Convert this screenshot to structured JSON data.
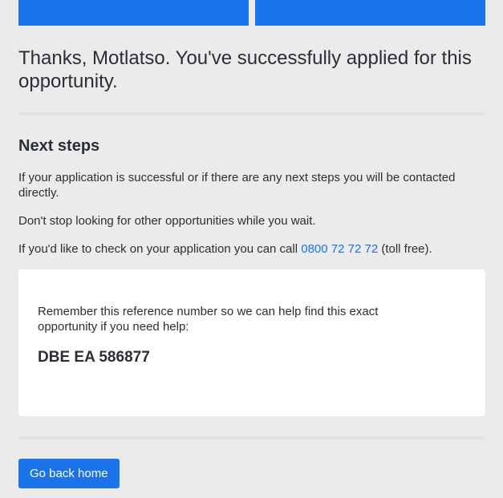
{
  "progress": {
    "steps_completed": 2,
    "steps_total": 2,
    "accent_color": "#1a73e8"
  },
  "confirmation": {
    "headline": "Thanks, Motlatso. You've successfully applied for this opportunity."
  },
  "next_steps": {
    "title": "Next steps",
    "paragraph_1": "If your application is successful or if there are any next steps you will be contacted directly.",
    "paragraph_2": "Don't stop looking for other opportunities while you wait.",
    "paragraph_3_prefix": "If you'd like to check on your application you can call ",
    "phone_link": "0800 72 72 72",
    "paragraph_3_suffix": " (toll free)."
  },
  "reference_card": {
    "text": "Remember this reference number so we can help find this exact opportunity if you need help:",
    "reference_number": "DBE EA 586877"
  },
  "actions": {
    "go_back_home_label": "Go back home"
  }
}
